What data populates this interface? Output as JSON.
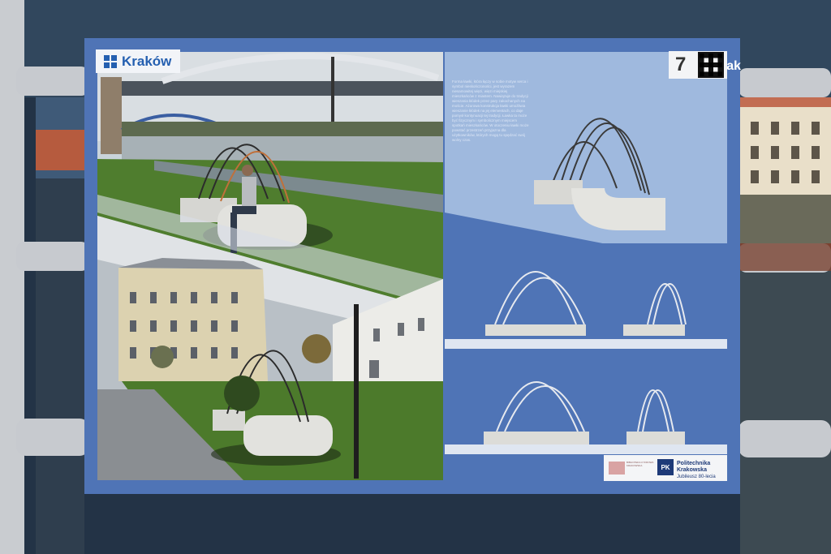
{
  "poster": {
    "brand": "Kraków",
    "author": "Alicja Rak",
    "number": "7",
    "description": "Forma ławki, która łączy w sobie motyw serca i symbol nieskończoności, jest wyrazem niesamowitej więzi, więzi miejskiej mieszkańców z miastem. Nawiązuje do tradycji wieszania kłódek przez pary zakochanych na moście. Ażurowa konstrukcja ławki umożliwia wieszanie kłódek na jej elementach, co daje pomysł kontynuacji tej tradycji. Ławka ta może być fizycznym i symbolicznym miejscem spotkań mieszkańców. W otoczeniu ławki może powstać przestrzeń przyjazna dla użytkowników, których mogą tu spędzać swój wolny czas.",
    "logo_left_text": "BIBLIOTEKA CYFROWA KRAKOWSKA",
    "logo_right_mark": "PK",
    "logo_right_line1": "Politechnika",
    "logo_right_line2": "Krakowska",
    "logo_right_line3": "Jubileusz 80-lecia"
  },
  "colors": {
    "poster_blue": "#4f74b6",
    "light_blue": "#9fb9de",
    "river": "#2b3a4c",
    "grass": "#4f7d2e"
  }
}
